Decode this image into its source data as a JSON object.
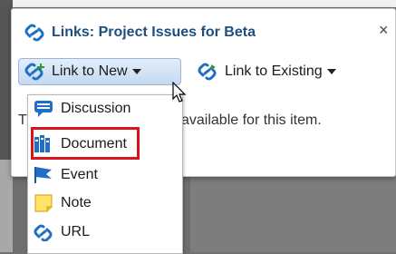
{
  "dialog": {
    "title": "Links: Project Issues for Beta",
    "close_label": "×"
  },
  "toolbar": {
    "link_new_label": "Link to New",
    "link_existing_label": "Link to Existing"
  },
  "status": {
    "prefix": "T",
    "suffix": "available for this item."
  },
  "menu": {
    "items": [
      {
        "label": "Discussion",
        "icon": "discussion-icon"
      },
      {
        "label": "Document",
        "icon": "document-icon",
        "highlighted": true
      },
      {
        "label": "Event",
        "icon": "event-flag-icon"
      },
      {
        "label": "Note",
        "icon": "note-icon"
      },
      {
        "label": "URL",
        "icon": "url-link-icon"
      }
    ]
  },
  "colors": {
    "title": "#1c4e80",
    "highlight_border": "#d9141c",
    "link_icon": "#1f6fc4"
  }
}
